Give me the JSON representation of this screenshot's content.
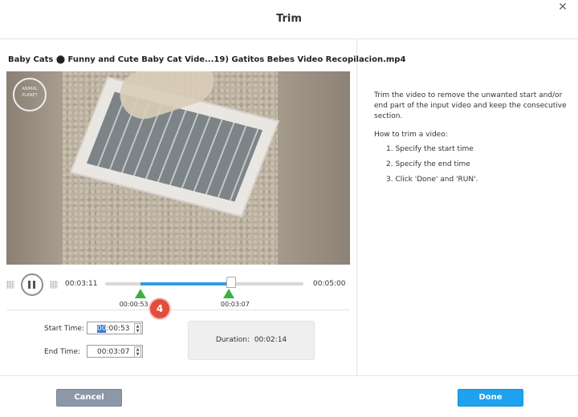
{
  "dialog": {
    "title": "Trim",
    "close_label": "✕"
  },
  "video": {
    "filename": "Baby Cats ⬤ Funny and Cute Baby Cat Vide...19) Gatitos Bebes Video Recopilacion.mp4",
    "watermark": "ANIMAL PLANET"
  },
  "player": {
    "current_time": "00:03:11",
    "total_time": "00:05:00",
    "start_marker": "00:00:53",
    "end_marker": "00:03:07",
    "playhead_fraction": 0.637,
    "range_start_fraction": 0.177,
    "range_end_fraction": 0.623
  },
  "annotation": {
    "badge": "4"
  },
  "trim": {
    "start_label": "Start Time:",
    "start_value_hl": "00",
    "start_value_rest": ":00:53",
    "end_label": "End Time:",
    "end_value": "00:03:07",
    "duration_label": "Duration:",
    "duration_value": "00:02:14"
  },
  "help": {
    "description": "Trim the video to remove the unwanted start and/or end part of the input video and keep the consecutive section.",
    "howto_title": "How to trim a video:",
    "steps": [
      "1. Specify the start time",
      "2. Specify the end time",
      "3. Click 'Done' and 'RUN'."
    ]
  },
  "footer": {
    "cancel_label": "Cancel",
    "done_label": "Done"
  },
  "colors": {
    "accent": "#1fa2f0",
    "range": "#2f9ee2",
    "handle": "#3db043",
    "badge": "#e24d3c"
  }
}
